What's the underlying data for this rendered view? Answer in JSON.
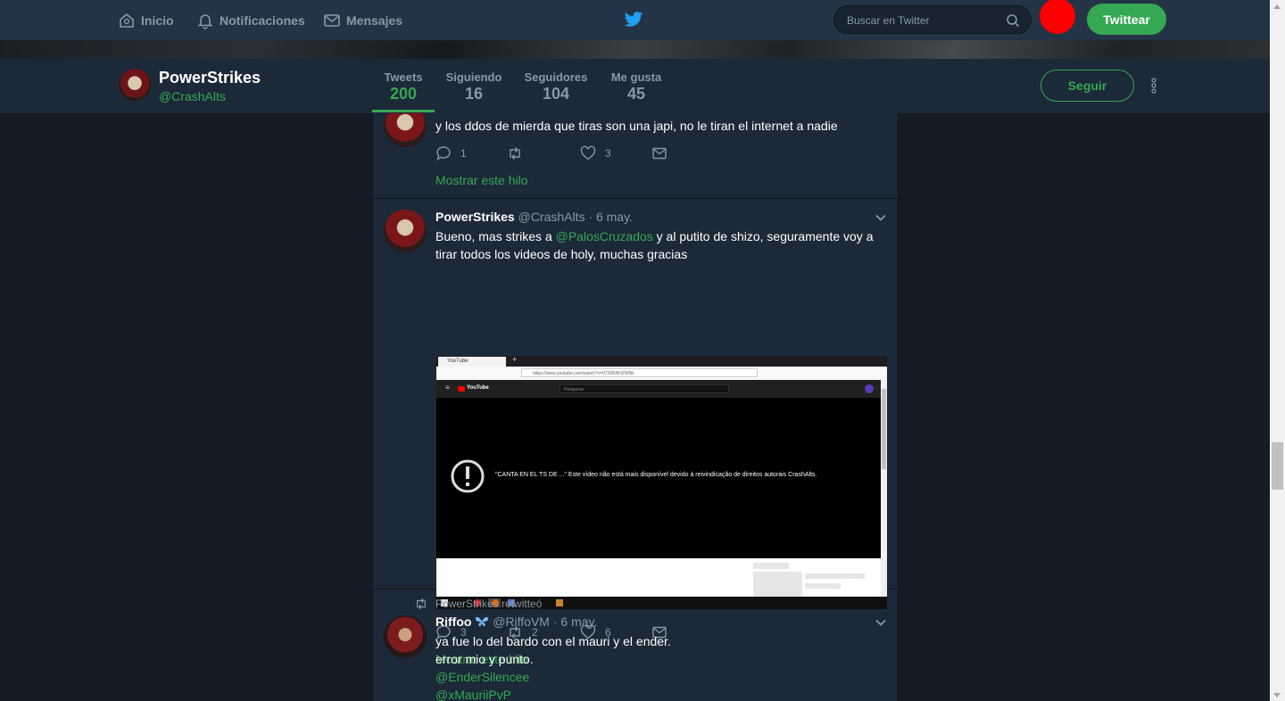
{
  "nav": {
    "home": "Inicio",
    "notifications": "Notificaciones",
    "messages": "Mensajes",
    "search_placeholder": "Buscar en Twitter",
    "tweet_button": "Twittear"
  },
  "profile": {
    "name": "PowerStrikes",
    "handle": "@CrashAlts",
    "stats": [
      {
        "label": "Tweets",
        "value": "200"
      },
      {
        "label": "Siguiendo",
        "value": "16"
      },
      {
        "label": "Seguidores",
        "value": "104"
      },
      {
        "label": "Me gusta",
        "value": "45"
      }
    ],
    "follow_button": "Seguir"
  },
  "tweets": [
    {
      "text": "y los ddos de mierda que tiras son una japi, no le tiran el internet a nadie",
      "replies": "1",
      "retweets": "",
      "likes": "3",
      "thread": "Mostrar este hilo"
    },
    {
      "name": "PowerStrikes",
      "handle": "@CrashAlts",
      "time": "6 may.",
      "text_before": "Bueno, mas strikes a ",
      "mention": "@PalosCruzados",
      "text_after": " y al putito de shizo, seguramente voy a tirar todos los videos de holy, muchas gracias",
      "media": {
        "tab_title": "YouTube",
        "url": "https://www.youtube.com/watch?v=0730KRHZWNk",
        "yt_logo": "YouTube",
        "yt_search_placeholder": "Pesquisar",
        "message": "\"CANTA EN EL TS DE ...\" Este vídeo não está mais disponível devido à reivindicação de direitos autorais CrashAlts."
      },
      "replies": "3",
      "retweets": "2",
      "likes": "6",
      "thread": "Mostrar este hilo"
    },
    {
      "retweeted_by": "PowerStrikes retwitteó",
      "name": "Riffoo",
      "handle": "@RiffoVM",
      "time": "6 may.",
      "lines": [
        "ya fue lo del bardo con el mauri y el ender.",
        "error mio y punto."
      ],
      "mentions": [
        "@EnderSilencee",
        "@xMauriiPvP"
      ]
    }
  ],
  "colors": {
    "accent": "#35a853",
    "background": "#141d26",
    "card": "#1c2938",
    "header": "#243447"
  }
}
